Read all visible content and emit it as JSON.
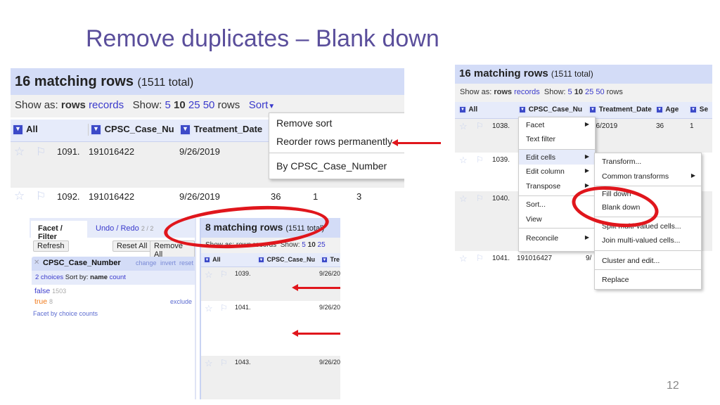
{
  "slide": {
    "title": "Remove duplicates – Blank down",
    "page_number": "12"
  },
  "accent": "#e0161c",
  "panel_a": {
    "matching": "16 matching rows",
    "total": "(1511 total)",
    "show_as": "Show as:",
    "rows": "rows",
    "records": "records",
    "show": "Show:",
    "n5": "5",
    "n10": "10",
    "n25": "25",
    "n50": "50",
    "rows_label": "rows",
    "sort": "Sort",
    "columns": [
      "All",
      "CPSC_Case_Nu",
      "Treatment_Date"
    ],
    "data_rows": [
      {
        "n": "1091.",
        "case": "191016422",
        "date": "9/26/2019"
      },
      {
        "n": "1092.",
        "case": "191016422",
        "date": "9/26/2019",
        "age": "36",
        "c1": "1",
        "c2": "3"
      }
    ],
    "sort_menu": [
      "Remove sort",
      "Reorder rows permanently",
      "By CPSC_Case_Number"
    ]
  },
  "panel_b": {
    "tabs": {
      "facet": "Facet / Filter",
      "undo": "Undo / Redo",
      "undo_count": "2 / 2"
    },
    "buttons": {
      "refresh": "Refresh",
      "reset_all": "Reset All",
      "remove_all": "Remove All"
    },
    "facet": {
      "name": "CPSC_Case_Number",
      "change": "change",
      "invert": "invert",
      "reset": "reset",
      "choices": "2 choices",
      "sort_by": "Sort by:",
      "name_opt": "name",
      "count_opt": "count",
      "items": [
        {
          "label": "false",
          "count": "1503"
        },
        {
          "label": "true",
          "count": "8",
          "action": "exclude"
        }
      ],
      "by_counts": "Facet by choice counts"
    },
    "matching": "8 matching rows",
    "total": "(1511 total)",
    "toolbar": "Show as: rows records",
    "show": "Show:",
    "n5": "5",
    "n10": "10",
    "n25": "25",
    "columns": [
      "All",
      "CPSC_Case_Nu",
      "Tre"
    ],
    "data_rows": [
      {
        "n": "1039.",
        "date": "9/26/20"
      },
      {
        "n": "1041.",
        "date": "9/26/20"
      },
      {
        "n": "1043.",
        "date": "9/26/20"
      }
    ]
  },
  "panel_c": {
    "matching": "16 matching rows",
    "total": "(1511 total)",
    "show_as": "Show as:",
    "rows": "rows",
    "records": "records",
    "show": "Show:",
    "n5": "5",
    "n10": "10",
    "n25": "25",
    "n50": "50",
    "rows_label": "rows",
    "columns": [
      "All",
      "CPSC_Case_Nu",
      "Treatment_Date",
      "Age",
      "Se"
    ],
    "data_rows": [
      {
        "n": "1038.",
        "date": "26/2019",
        "age": "36",
        "sex": "1"
      },
      {
        "n": "1039."
      },
      {
        "n": "1040."
      },
      {
        "n": "1041.",
        "case": "191016427",
        "date": "9/"
      }
    ],
    "column_menu": [
      "Facet",
      "Text filter",
      "Edit cells",
      "Edit column",
      "Transpose",
      "Sort...",
      "View",
      "Reconcile"
    ],
    "edit_cells_menu": [
      "Transform...",
      "Common transforms",
      "Fill down",
      "Blank down",
      "Split multi-valued cells...",
      "Join multi-valued cells...",
      "Cluster and edit...",
      "Replace"
    ]
  }
}
